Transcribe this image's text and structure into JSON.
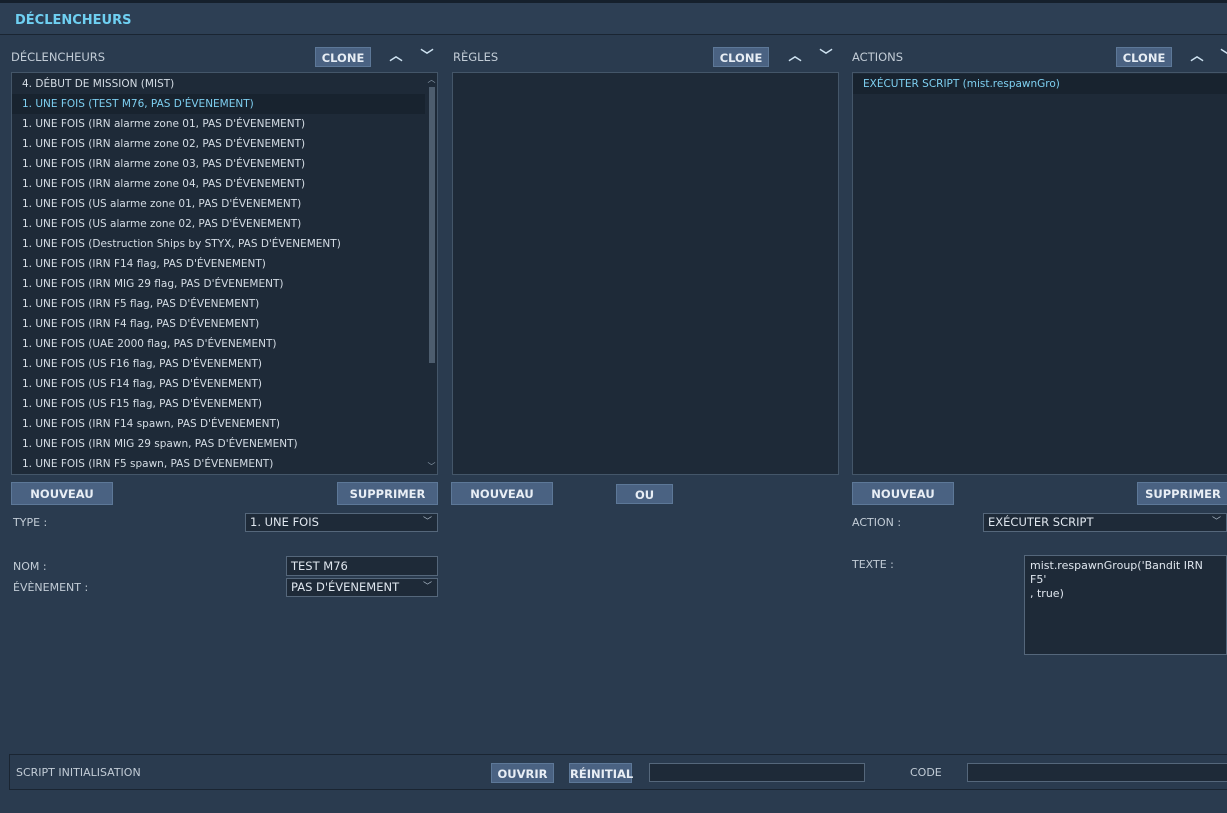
{
  "header": {
    "title": "DÉCLENCHEURS"
  },
  "triggers": {
    "label": "DÉCLENCHEURS",
    "clone": "CLONE",
    "items": [
      "4. DÉBUT DE MISSION (MIST)",
      "1. UNE FOIS (TEST M76, PAS D'ÉVENEMENT)",
      "1. UNE FOIS (IRN alarme zone 01, PAS D'ÉVENEMENT)",
      "1. UNE FOIS (IRN alarme zone 02, PAS D'ÉVENEMENT)",
      "1. UNE FOIS (IRN alarme zone 03, PAS D'ÉVENEMENT)",
      "1. UNE FOIS (IRN alarme zone 04, PAS D'ÉVENEMENT)",
      "1. UNE FOIS (US alarme zone 01, PAS D'ÉVENEMENT)",
      "1. UNE FOIS (US alarme zone 02, PAS D'ÉVENEMENT)",
      "1. UNE FOIS (Destruction Ships by STYX, PAS D'ÉVENEMENT)",
      "1. UNE FOIS (IRN F14 flag, PAS D'ÉVENEMENT)",
      "1. UNE FOIS (IRN MIG 29 flag, PAS D'ÉVENEMENT)",
      "1. UNE FOIS (IRN F5 flag, PAS D'ÉVENEMENT)",
      "1. UNE FOIS (IRN F4 flag, PAS D'ÉVENEMENT)",
      "1. UNE FOIS (UAE 2000 flag, PAS D'ÉVENEMENT)",
      "1. UNE FOIS (US F16 flag, PAS D'ÉVENEMENT)",
      "1. UNE FOIS (US F14 flag, PAS D'ÉVENEMENT)",
      "1. UNE FOIS (US F15 flag, PAS D'ÉVENEMENT)",
      "1. UNE FOIS (IRN F14 spawn, PAS D'ÉVENEMENT)",
      "1. UNE FOIS (IRN MIG 29 spawn, PAS D'ÉVENEMENT)",
      "1. UNE FOIS (IRN F5 spawn, PAS D'ÉVENEMENT)"
    ],
    "nouveau": "NOUVEAU",
    "supprimer": "SUPPRIMER",
    "type_label": "TYPE :",
    "type_value": "1. UNE FOIS",
    "nom_label": "NOM :",
    "nom_value": "TEST M76",
    "evenement_label": "ÉVÈNEMENT :",
    "evenement_value": "PAS D'ÉVENEMENT"
  },
  "rules": {
    "label": "RÈGLES",
    "clone": "CLONE",
    "nouveau": "NOUVEAU",
    "ou": "OU"
  },
  "actions": {
    "label": "ACTIONS",
    "clone": "CLONE",
    "items": [
      "EXÉCUTER SCRIPT (mist.respawnGro)"
    ],
    "nouveau": "NOUVEAU",
    "supprimer": "SUPPRIMER",
    "action_label": "ACTION :",
    "action_value": "EXÉCUTER SCRIPT",
    "texte_label": "TEXTE :",
    "texte_value": "mist.respawnGroup('Bandit IRN F5'\n, true)"
  },
  "bottom": {
    "label": "SCRIPT INITIALISATION",
    "ouvrir": "OUVRIR",
    "reinitial": "RÉINITIAL",
    "code_label": "CODE"
  },
  "icons": {
    "up": "chevron-up-icon",
    "down": "chevron-down-icon"
  },
  "colors": {
    "accent": "#6fd0f2",
    "panel": "#2a3b4f",
    "list_bg": "#1e2a38",
    "button": "#4a6282"
  }
}
